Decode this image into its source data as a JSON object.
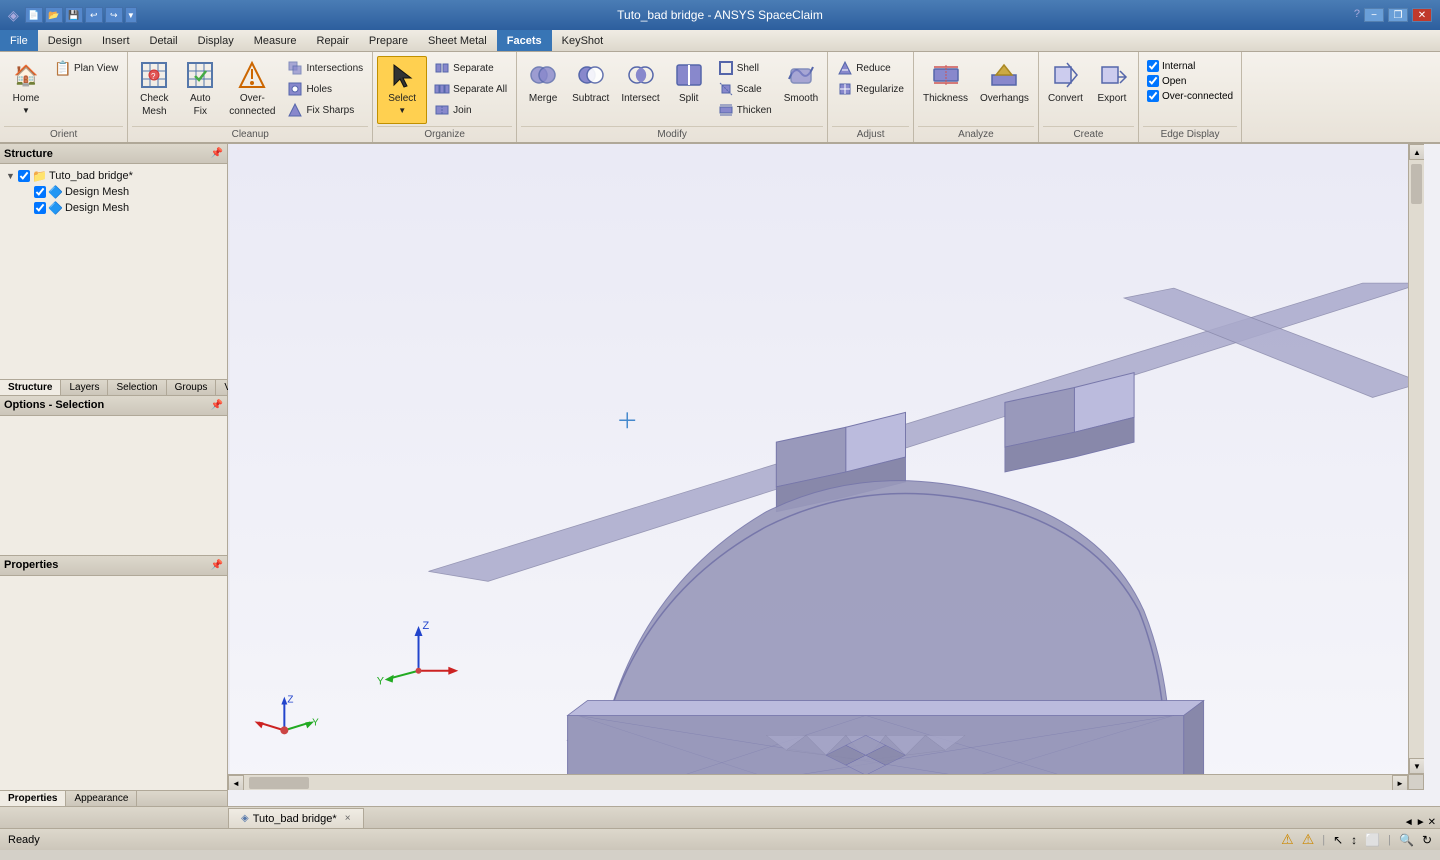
{
  "titlebar": {
    "title": "Tuto_bad bridge - ANSYS SpaceClaim",
    "minimize": "−",
    "maximize": "□",
    "close": "✕",
    "restore": "❐"
  },
  "menubar": {
    "items": [
      "File",
      "Design",
      "Insert",
      "Detail",
      "Display",
      "Measure",
      "Repair",
      "Prepare",
      "Sheet Metal",
      "Facets",
      "KeyShot"
    ],
    "active": "Facets"
  },
  "ribbon": {
    "groups": [
      {
        "label": "Orient",
        "items": [
          {
            "type": "big",
            "icon": "🏠",
            "label": "Home"
          },
          {
            "type": "small-col",
            "items": [
              {
                "icon": "📋",
                "label": "Plan View"
              }
            ]
          }
        ]
      },
      {
        "label": "Cleanup",
        "items": [
          {
            "type": "big",
            "icon": "🔍",
            "label": "Check Mesh"
          },
          {
            "type": "big",
            "icon": "⚙",
            "label": "Auto Fix"
          },
          {
            "type": "big",
            "icon": "🔗",
            "label": "Over-connected"
          },
          {
            "type": "big-col",
            "items": [
              {
                "icon": "⬡",
                "label": "Intersections"
              },
              {
                "icon": "⬤",
                "label": "Holes"
              },
              {
                "icon": "🔧",
                "label": "Fix Sharps"
              }
            ]
          }
        ]
      },
      {
        "label": "Organize",
        "items": [
          {
            "type": "big-active",
            "icon": "↖",
            "label": "Select"
          },
          {
            "type": "small-col",
            "items": [
              {
                "icon": "⊕",
                "label": "Separate"
              },
              {
                "icon": "⊕",
                "label": "Separate All"
              },
              {
                "icon": "⊕",
                "label": "Join"
              }
            ]
          }
        ]
      },
      {
        "label": "Modify",
        "items": [
          {
            "type": "big",
            "icon": "⬡",
            "label": "Merge"
          },
          {
            "type": "big",
            "icon": "⊖",
            "label": "Subtract"
          },
          {
            "type": "big",
            "icon": "✕",
            "label": "Intersect"
          },
          {
            "type": "big",
            "icon": "✂",
            "label": "Split"
          },
          {
            "type": "big-col",
            "items": [
              {
                "icon": "⬡",
                "label": "Shell"
              },
              {
                "icon": "📐",
                "label": "Scale"
              },
              {
                "icon": "⬡",
                "label": "Thicken"
              }
            ]
          },
          {
            "type": "big",
            "icon": "〰",
            "label": "Smooth"
          }
        ]
      },
      {
        "label": "Adjust",
        "items": [
          {
            "type": "big-col",
            "items": [
              {
                "icon": "▲",
                "label": "Reduce"
              },
              {
                "icon": "⬡",
                "label": "Regularize"
              }
            ]
          }
        ]
      },
      {
        "label": "Analyze",
        "items": [
          {
            "type": "big",
            "icon": "📏",
            "label": "Thickness"
          },
          {
            "type": "big",
            "icon": "⬡",
            "label": "Overhangs"
          }
        ]
      },
      {
        "label": "Create",
        "items": [
          {
            "type": "big",
            "icon": "□",
            "label": "Convert"
          },
          {
            "type": "big",
            "icon": "↗",
            "label": "Export"
          }
        ]
      },
      {
        "label": "Edge Display",
        "checkboxes": [
          {
            "label": "Internal",
            "checked": true
          },
          {
            "label": "Open",
            "checked": true
          },
          {
            "label": "Over-connected",
            "checked": true
          }
        ]
      }
    ]
  },
  "structure": {
    "title": "Structure",
    "tree": {
      "root": {
        "label": "Tuto_bad bridge*",
        "expanded": true,
        "children": [
          {
            "label": "Design Mesh",
            "checked": true,
            "icon": "🔷"
          },
          {
            "label": "Design Mesh",
            "checked": true,
            "icon": "🔷"
          }
        ]
      }
    }
  },
  "panel_tabs": [
    "Structure",
    "Layers",
    "Selection",
    "Groups",
    "Views"
  ],
  "options_panel": {
    "title": "Options - Selection",
    "content": ""
  },
  "properties_panel": {
    "title": "Properties",
    "content": ""
  },
  "prop_tabs": [
    "Properties",
    "Appearance"
  ],
  "bottom_tab": {
    "label": "Tuto_bad bridge*",
    "close": "×"
  },
  "statusbar": {
    "status": "Ready",
    "icons": [
      "⚠",
      "⚠"
    ]
  },
  "viewport": {
    "crosshair": "✛"
  }
}
